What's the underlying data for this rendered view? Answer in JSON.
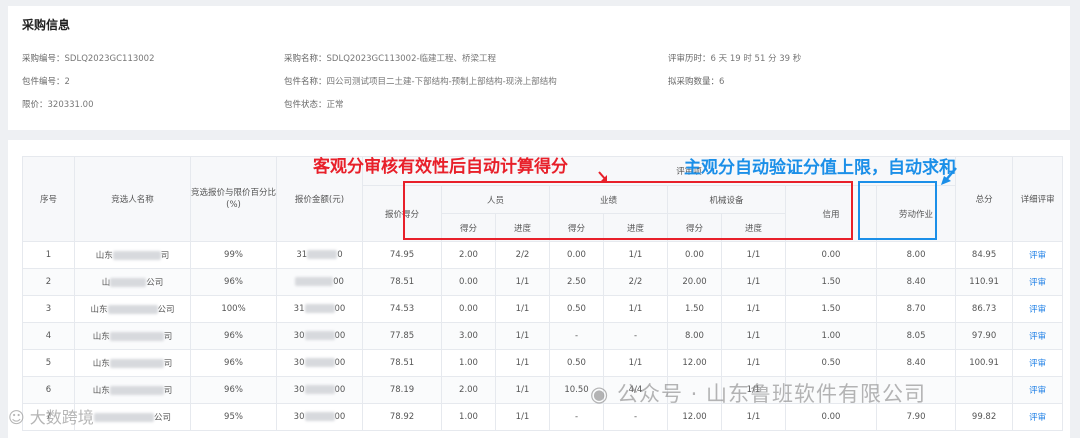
{
  "purchase_info": {
    "title": "采购信息",
    "items": [
      {
        "key": "采购编号：",
        "value": "SDLQ2023GC113002"
      },
      {
        "key": "采购名称：",
        "value": "SDLQ2023GC113002-临建工程、桥梁工程"
      },
      {
        "key": "评审历时：",
        "value": "6 天 19 时 51 分 39 秒"
      },
      {
        "key": "包件编号：",
        "value": "2"
      },
      {
        "key": "包件名称：",
        "value": "四公司测试项目二土建-下部结构-预制上部结构-现浇上部结构"
      },
      {
        "key": "拟采购数量：",
        "value": "6"
      },
      {
        "key": "限价：",
        "value": "320331.00"
      },
      {
        "key": "包件状态：",
        "value": "正常"
      }
    ]
  },
  "table": {
    "headers": {
      "seq": "序号",
      "name": "竞选人名称",
      "percent": "竞选报价与限价百分比(%)",
      "amount": "报价金额(元)",
      "review_items": "评审项",
      "price_score": "报价得分",
      "personnel": "人员",
      "performance": "业绩",
      "machinery": "机械设备",
      "credit": "信用",
      "labor": "劳动作业",
      "total": "总分",
      "detail": "详细评审",
      "score": "得分",
      "progress": "进度"
    },
    "rows": [
      {
        "seq": "1",
        "name_a": "山东",
        "name_b": "司",
        "percent": "99%",
        "amt_a": "31",
        "amt_b": "0",
        "price": "74.95",
        "p_s": "2.00",
        "p_p": "2/2",
        "y_s": "0.00",
        "y_p": "1/1",
        "m_s": "0.00",
        "m_p": "1/1",
        "credit": "0.00",
        "labor": "8.00",
        "total": "84.95",
        "detail": "评审"
      },
      {
        "seq": "2",
        "name_a": "山",
        "name_b": "公司",
        "percent": "96%",
        "amt_a": "",
        "amt_b": "00",
        "price": "78.51",
        "p_s": "0.00",
        "p_p": "1/1",
        "y_s": "2.50",
        "y_p": "2/2",
        "m_s": "20.00",
        "m_p": "1/1",
        "credit": "1.50",
        "labor": "8.40",
        "total": "110.91",
        "detail": "评审"
      },
      {
        "seq": "3",
        "name_a": "山东",
        "name_b": "公司",
        "percent": "100%",
        "amt_a": "31",
        "amt_b": "00",
        "price": "74.53",
        "p_s": "0.00",
        "p_p": "1/1",
        "y_s": "0.50",
        "y_p": "1/1",
        "m_s": "1.50",
        "m_p": "1/1",
        "credit": "1.50",
        "labor": "8.70",
        "total": "86.73",
        "detail": "评审"
      },
      {
        "seq": "4",
        "name_a": "山东",
        "name_b": "司",
        "percent": "96%",
        "amt_a": "30",
        "amt_b": "00",
        "price": "77.85",
        "p_s": "3.00",
        "p_p": "1/1",
        "y_s": "-",
        "y_p": "-",
        "m_s": "8.00",
        "m_p": "1/1",
        "credit": "1.00",
        "labor": "8.05",
        "total": "97.90",
        "detail": "评审"
      },
      {
        "seq": "5",
        "name_a": "山东",
        "name_b": "司",
        "percent": "96%",
        "amt_a": "30",
        "amt_b": "00",
        "price": "78.51",
        "p_s": "1.00",
        "p_p": "1/1",
        "y_s": "0.50",
        "y_p": "1/1",
        "m_s": "12.00",
        "m_p": "1/1",
        "credit": "0.50",
        "labor": "8.40",
        "total": "100.91",
        "detail": "评审"
      },
      {
        "seq": "6",
        "name_a": "山东",
        "name_b": "司",
        "percent": "96%",
        "amt_a": "30",
        "amt_b": "00",
        "price": "78.19",
        "p_s": "2.00",
        "p_p": "1/1",
        "y_s": "10.50",
        "y_p": "4/4",
        "m_s": "",
        "m_p": "1/1",
        "credit": "",
        "labor": "",
        "total": "",
        "detail": "评审"
      },
      {
        "seq": "7",
        "name_a": "",
        "name_b": "公司",
        "percent": "95%",
        "amt_a": "30",
        "amt_b": "00",
        "price": "78.92",
        "p_s": "1.00",
        "p_p": "1/1",
        "y_s": "-",
        "y_p": "-",
        "m_s": "12.00",
        "m_p": "1/1",
        "credit": "0.00",
        "labor": "7.90",
        "total": "99.82",
        "detail": "评审"
      }
    ]
  },
  "annotations": {
    "red": "客观分审核有效性后自动计算得分",
    "blue": "主观分自动验证分值上限，自动求和"
  },
  "watermarks": {
    "right": "公众号 · 山东鲁班软件有限公司",
    "left": "大数跨境"
  }
}
